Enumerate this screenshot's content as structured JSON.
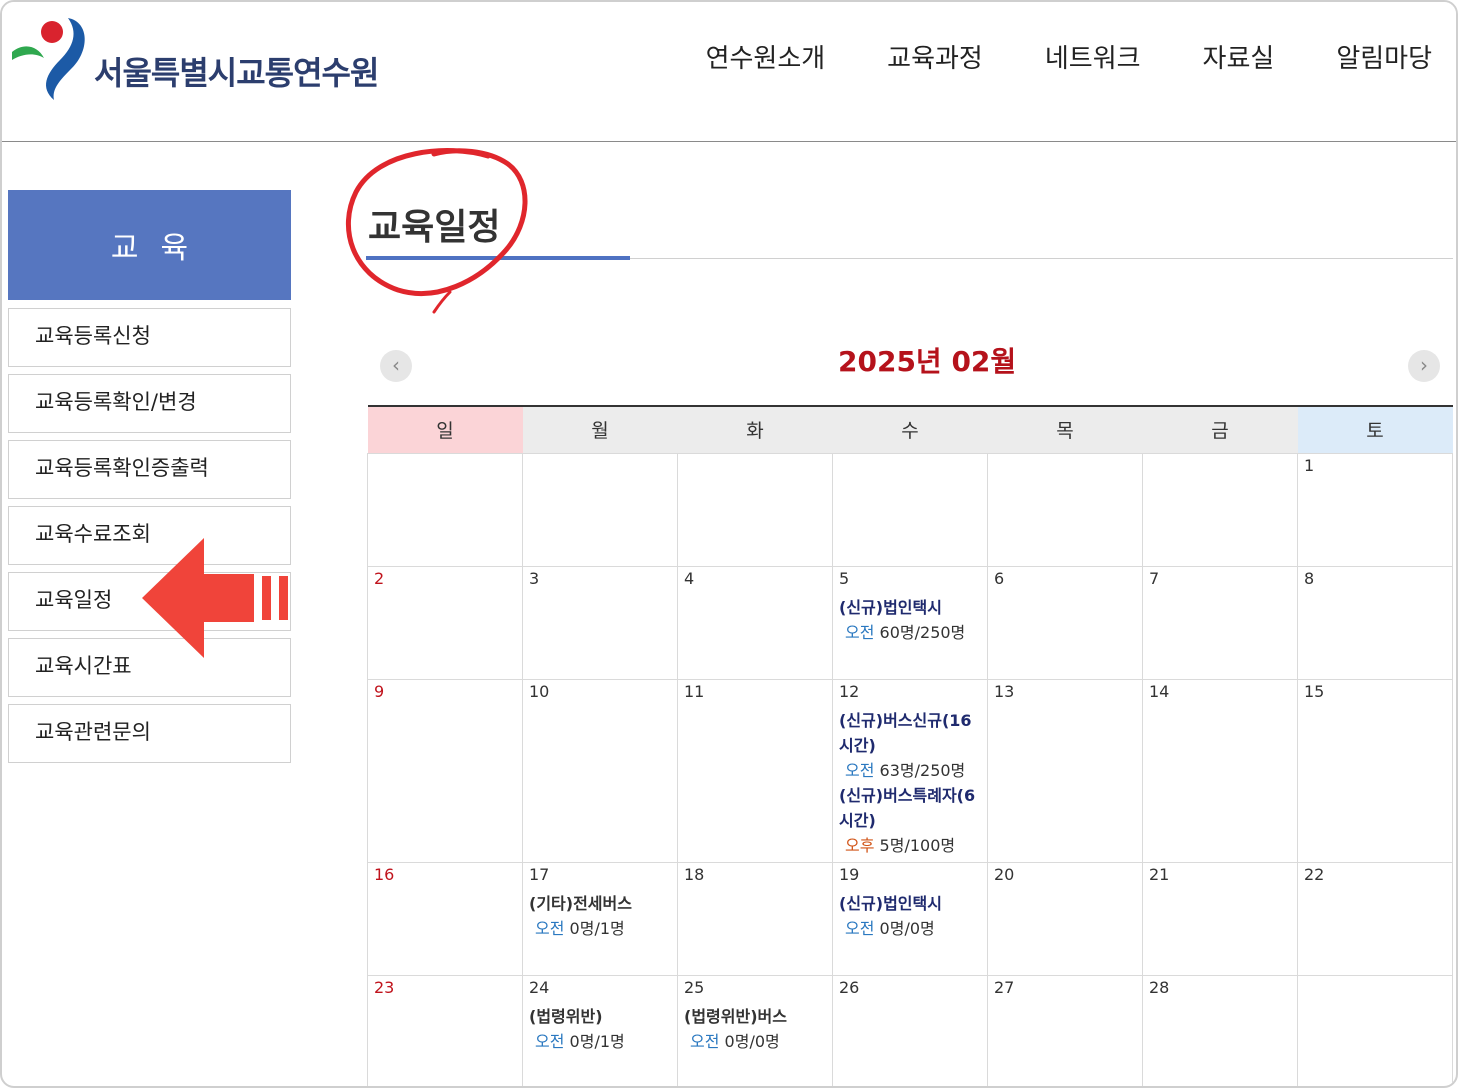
{
  "header": {
    "logo_text": "서울특별시교통연수원",
    "nav": [
      "연수원소개",
      "교육과정",
      "네트워크",
      "자료실",
      "알림마당"
    ]
  },
  "sidebar": {
    "title": "교육",
    "items": [
      {
        "label": "교육등록신청"
      },
      {
        "label": "교육등록확인/변경"
      },
      {
        "label": "교육등록확인증출력"
      },
      {
        "label": "교육수료조회"
      },
      {
        "label": "교육일정"
      },
      {
        "label": "교육시간표"
      },
      {
        "label": "교육관련문의"
      }
    ]
  },
  "content": {
    "page_title": "교육일정",
    "month": "2025년 02월",
    "prev_icon": "‹",
    "next_icon": "›",
    "weekdays": [
      "일",
      "월",
      "화",
      "수",
      "목",
      "금",
      "토"
    ]
  },
  "calendar": {
    "weeks": [
      [
        {
          "day": ""
        },
        {
          "day": ""
        },
        {
          "day": ""
        },
        {
          "day": ""
        },
        {
          "day": ""
        },
        {
          "day": ""
        },
        {
          "day": "1"
        }
      ],
      [
        {
          "day": "2"
        },
        {
          "day": "3"
        },
        {
          "day": "4"
        },
        {
          "day": "5",
          "events": [
            {
              "title": "(신규)법인택시",
              "period": "오전",
              "count": "60명/250명"
            }
          ]
        },
        {
          "day": "6"
        },
        {
          "day": "7"
        },
        {
          "day": "8"
        }
      ],
      [
        {
          "day": "9"
        },
        {
          "day": "10"
        },
        {
          "day": "11"
        },
        {
          "day": "12",
          "events": [
            {
              "title": "(신규)버스신규(16시간)",
              "period": "오전",
              "count": "63명/250명"
            },
            {
              "title": "(신규)버스특례자(6시간)",
              "period": "오후",
              "count": "5명/100명"
            }
          ]
        },
        {
          "day": "13"
        },
        {
          "day": "14"
        },
        {
          "day": "15"
        }
      ],
      [
        {
          "day": "16"
        },
        {
          "day": "17",
          "events": [
            {
              "title": "(기타)전세버스",
              "period": "오전",
              "count": "0명/1명"
            }
          ]
        },
        {
          "day": "18"
        },
        {
          "day": "19",
          "events": [
            {
              "title": "(신규)법인택시",
              "period": "오전",
              "count": "0명/0명"
            }
          ]
        },
        {
          "day": "20"
        },
        {
          "day": "21"
        },
        {
          "day": "22"
        }
      ],
      [
        {
          "day": "23"
        },
        {
          "day": "24",
          "events": [
            {
              "title": "(법령위반)",
              "period": "오전",
              "count": "0명/1명"
            }
          ]
        },
        {
          "day": "25",
          "events": [
            {
              "title": "(법령위반)버스",
              "period": "오전",
              "count": "0명/0명"
            }
          ]
        },
        {
          "day": "26"
        },
        {
          "day": "27"
        },
        {
          "day": "28"
        },
        {
          "day": ""
        }
      ]
    ]
  },
  "colors": {
    "accent_blue": "#5676c0",
    "month_red": "#b5121b",
    "event_navy": "#1f2a6e",
    "am_blue": "#2a78c0",
    "pm_orange": "#d2561a",
    "annotation_red": "#e8322b"
  }
}
